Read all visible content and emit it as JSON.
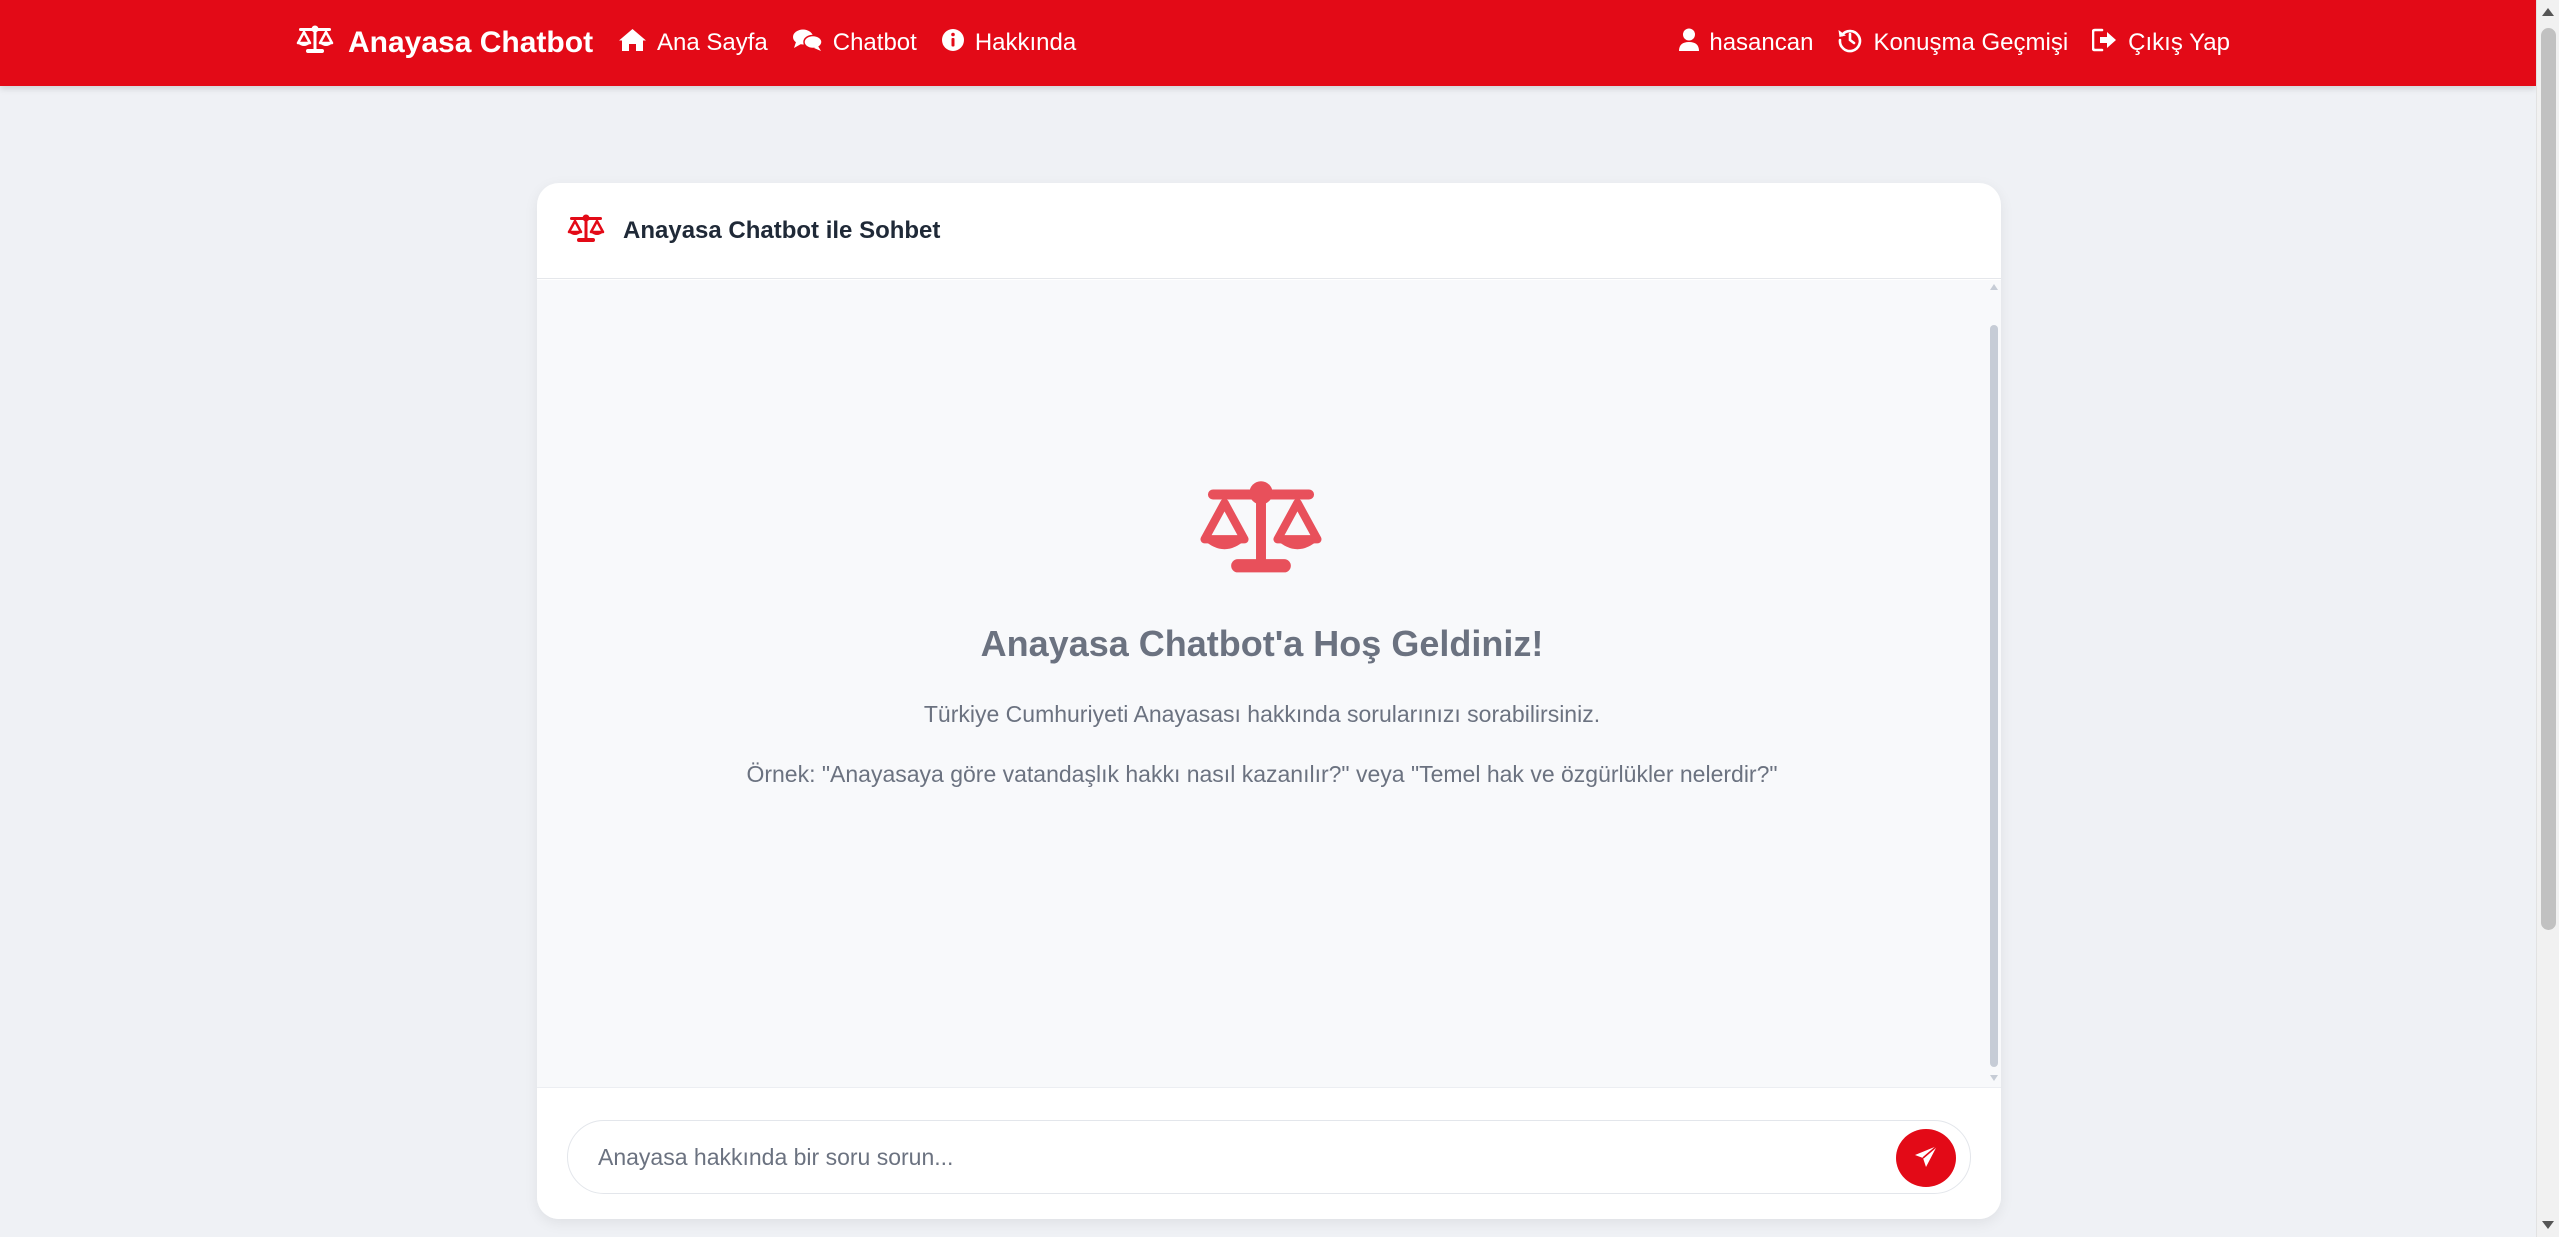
{
  "navbar": {
    "brand": "Anayasa Chatbot",
    "links": [
      {
        "label": "Ana Sayfa",
        "icon": "home-icon"
      },
      {
        "label": "Chatbot",
        "icon": "comments-icon"
      },
      {
        "label": "Hakkında",
        "icon": "info-icon"
      }
    ],
    "user": {
      "label": "hasancan",
      "icon": "user-icon"
    },
    "history": {
      "label": "Konuşma Geçmişi",
      "icon": "history-icon"
    },
    "logout": {
      "label": "Çıkış Yap",
      "icon": "logout-icon"
    }
  },
  "card": {
    "title": "Anayasa Chatbot ile Sohbet",
    "icon": "scale-icon"
  },
  "welcome": {
    "title": "Anayasa Chatbot'a Hoş Geldiniz!",
    "text": "Türkiye Cumhuriyeti Anayasası hakkında sorularınızı sorabilirsiniz.",
    "example": "Örnek: \"Anayasaya göre vatandaşlık hakkı nasıl kazanılır?\" veya \"Temel hak ve özgürlükler nelerdir?\""
  },
  "input": {
    "value": "",
    "placeholder": "Anayasa hakkında bir soru sorun..."
  },
  "colors": {
    "brand": "#e30a17",
    "welcome_icon": "#e8505b",
    "text_muted": "#6b7280",
    "background": "#eff1f5"
  }
}
